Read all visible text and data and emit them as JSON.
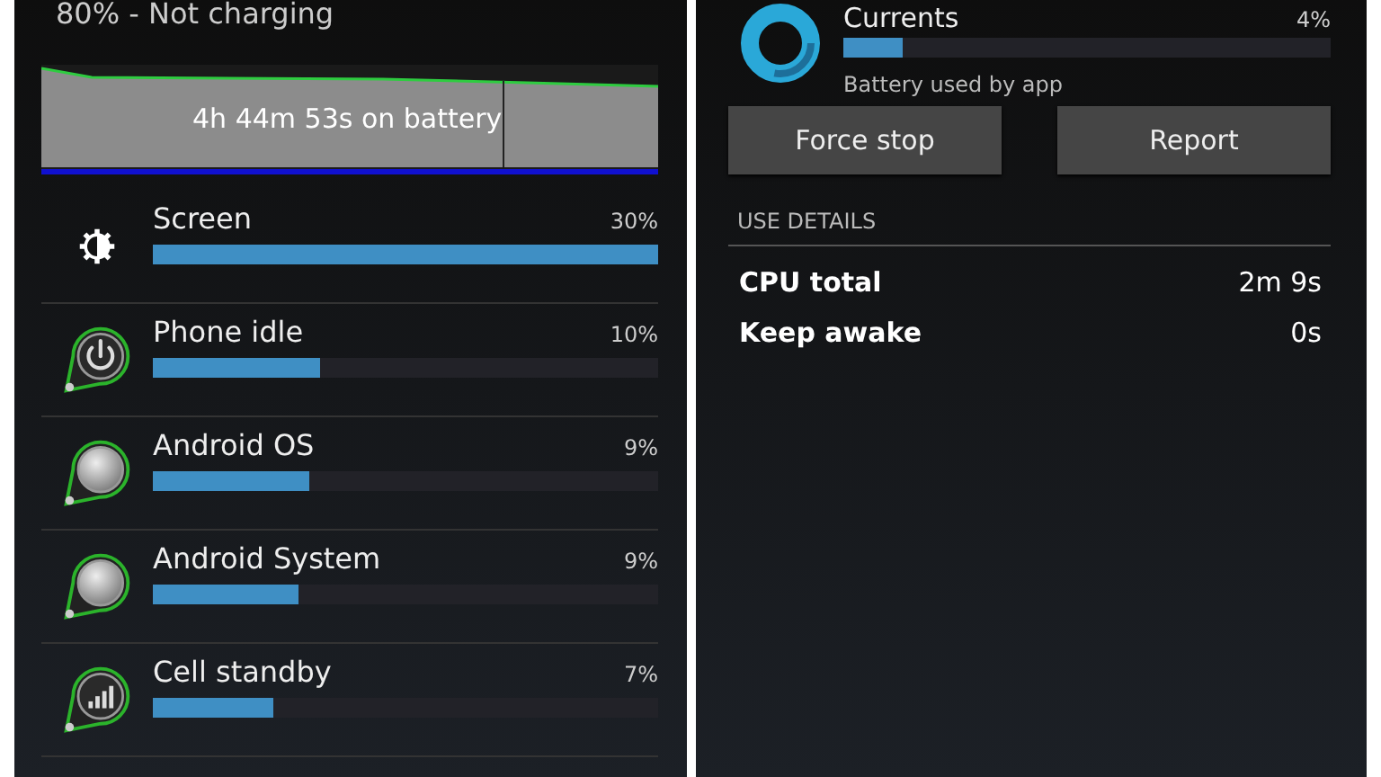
{
  "left": {
    "status": "80% - Not charging",
    "graph": {
      "caption": "4h 44m 53s on battery"
    },
    "items": [
      {
        "kind": "brightness",
        "name": "Screen",
        "percent": "30%",
        "level": 1
      },
      {
        "kind": "power",
        "name": "Phone idle",
        "percent": "10%",
        "level": 0.33
      },
      {
        "kind": "disc",
        "name": "Android OS",
        "percent": "9%",
        "level": 0.31
      },
      {
        "kind": "disc",
        "name": "Android System",
        "percent": "9%",
        "level": 0.29
      },
      {
        "kind": "signal",
        "name": "Cell standby",
        "percent": "7%",
        "level": 0.24
      }
    ]
  },
  "right": {
    "app": {
      "name": "Currents",
      "percent": "4%",
      "level": 0.12,
      "subtitle": "Battery used by app"
    },
    "buttons": [
      "Force stop",
      "Report"
    ],
    "section": "USE DETAILS",
    "details": [
      {
        "label": "CPU total",
        "value": "2m 9s"
      },
      {
        "label": "Keep awake",
        "value": "0s"
      }
    ]
  }
}
